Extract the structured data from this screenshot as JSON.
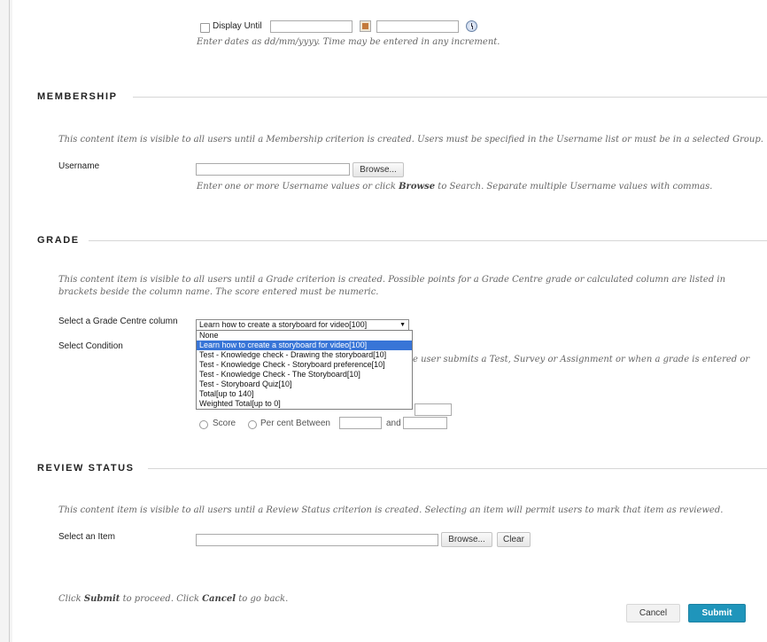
{
  "dates": {
    "display_until_label": "Display Until",
    "hint": "Enter dates as dd/mm/yyyy. Time may be entered in any increment."
  },
  "membership": {
    "title": "MEMBERSHIP",
    "description": "This content item is visible to all users until a Membership criterion is created. Users must be specified in the Username list or must be in a selected Group.",
    "username_label": "Username",
    "browse_label": "Browse...",
    "hint_before": "Enter one or more Username values or click",
    "hint_bold": "Browse",
    "hint_after": "to Search. Separate multiple Username values with commas."
  },
  "grade": {
    "title": "GRADE",
    "description": "This content item is visible to all users until a Grade criterion is created. Possible points for a Grade Centre grade or calculated column are listed in brackets beside the column name. The score entered must be numeric.",
    "column_label": "Select a Grade Centre column",
    "selected_value": "Learn how to create a storyboard for video[100]",
    "condition_label": "Select Condition",
    "condition_hint_partial": "e user submits a Test, Survey or Assignment or when a grade is entered or",
    "score_label": "Score",
    "percent_between_label": "Per cent Between",
    "and_label": "and",
    "options": [
      "None",
      "Learn how to create a storyboard for video[100]",
      "Test - Knowledge check - Drawing the storyboard[10]",
      "Test - Knowledge Check - Storyboard preference[10]",
      "Test - Knowledge Check - The Storyboard[10]",
      "Test - Storyboard Quiz[10]",
      "Total[up to 140]",
      "Weighted Total[up to 0]"
    ]
  },
  "review": {
    "title": "REVIEW STATUS",
    "description": "This content item is visible to all users until a Review Status criterion is created. Selecting an item will permit users to mark that item as reviewed.",
    "select_label": "Select an Item",
    "browse_label": "Browse...",
    "clear_label": "Clear"
  },
  "footer": {
    "click": "Click",
    "submit_word": "Submit",
    "to_proceed": "to proceed. Click",
    "cancel_word": "Cancel",
    "to_go_back": "to go back.",
    "cancel_button": "Cancel",
    "submit_button": "Submit"
  },
  "colors": {
    "submit_bg": "#1f95bb",
    "dropdown_highlight": "#3875d7"
  }
}
